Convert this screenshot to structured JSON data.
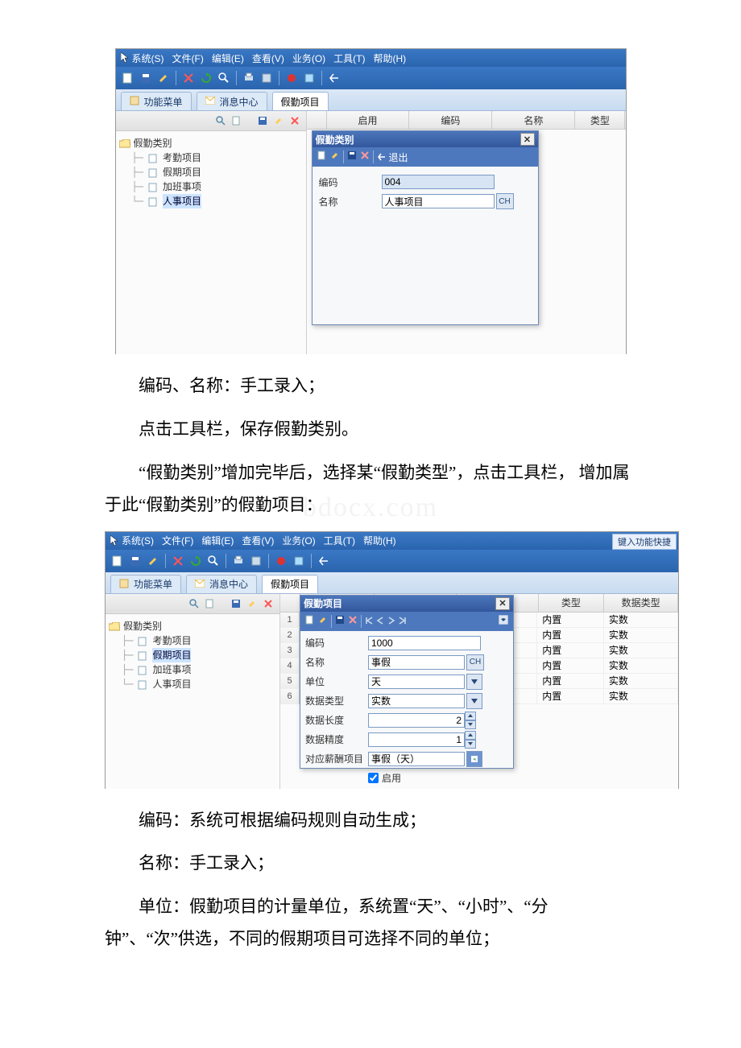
{
  "menu": {
    "system": "系统(S)",
    "file": "文件(F)",
    "edit": "编辑(E)",
    "view": "查看(V)",
    "biz": "业务(O)",
    "tool": "工具(T)",
    "help": "帮助(H)"
  },
  "tabs": {
    "function_menu": "功能菜单",
    "message_center": "消息中心",
    "attendance_item": "假勤项目"
  },
  "tree": {
    "root": "假勤类别",
    "children": [
      "考勤项目",
      "假期项目",
      "加班事项",
      "人事项目"
    ]
  },
  "grid_headers": {
    "rownum": "",
    "enable": "启用",
    "code": "编码",
    "name": "名称",
    "type": "类型",
    "data_type": "数据类型"
  },
  "dialog1": {
    "title": "假勤类别",
    "exit": "退出",
    "code_label": "编码",
    "code_value": "004",
    "name_label": "名称",
    "name_value": "人事项目",
    "ch": "CH"
  },
  "dialog2": {
    "title": "假勤项目",
    "code_label": "编码",
    "code_value": "1000",
    "name_label": "名称",
    "name_value": "事假",
    "unit_label": "单位",
    "unit_value": "天",
    "dtype_label": "数据类型",
    "dtype_value": "实数",
    "dlen_label": "数据长度",
    "dlen_value": "2",
    "dprec_label": "数据精度",
    "dprec_value": "1",
    "payitem_label": "对应薪酬项目",
    "payitem_value": "事假（天）",
    "enable_label": "启用",
    "ch": "CH"
  },
  "grid2_rows": [
    {
      "type": "内置",
      "dtype": "实数"
    },
    {
      "type": "内置",
      "dtype": "实数"
    },
    {
      "type": "内置",
      "dtype": "实数"
    },
    {
      "type": "内置",
      "dtype": "实数"
    },
    {
      "type": "内置",
      "dtype": "实数"
    },
    {
      "type": "内置",
      "dtype": "实数"
    }
  ],
  "kbd_hint": "键入功能快捷",
  "body_text": {
    "p1": "编码、名称：手工录入；",
    "p2": "点击工具栏，保存假勤类别。",
    "p3": "“假勤类别”增加完毕后，选择某“假勤类型”，点击工具栏， 增加属于此“假勤类别”的假勤项目：",
    "p4": "编码：系统可根据编码规则自动生成；",
    "p5": "名称：手工录入；",
    "p6": "单位：假勤项目的计量单位，系统置“天”、“小时”、“分钟”、“次”供选，不同的假期项目可选择不同的单位；"
  },
  "watermark": "bdocx.com"
}
